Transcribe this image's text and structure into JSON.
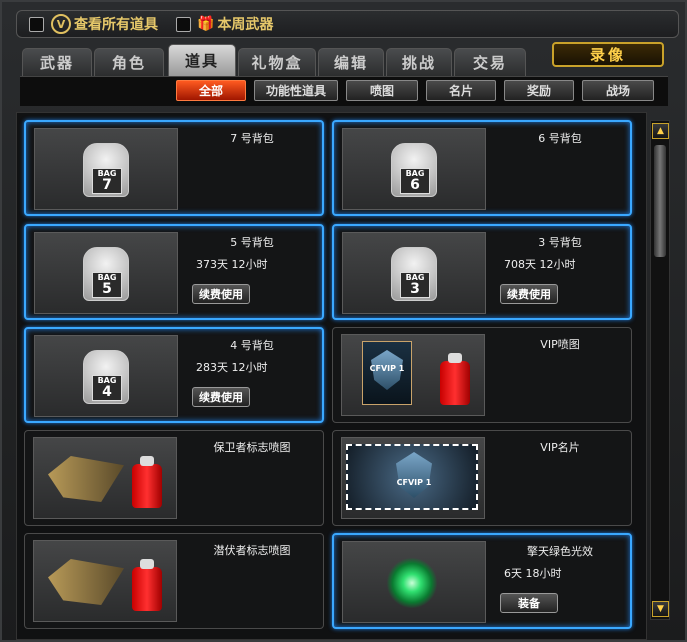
{
  "topbar": {
    "show_all_label": "查看所有道具",
    "weekly_weapons_label": "本周武器",
    "v_icon_glyph": "V",
    "gift_icon_glyph": "🎁"
  },
  "tabs": [
    "武器",
    "角色",
    "道具",
    "礼物盒",
    "编辑",
    "挑战",
    "交易"
  ],
  "active_tab_index": 2,
  "record_button": "录像",
  "subtabs": [
    "全部",
    "功能性道具",
    "喷图",
    "名片",
    "奖励",
    "战场"
  ],
  "active_subtab_index": 0,
  "items": [
    {
      "title": "7 号背包",
      "time": "",
      "button": "",
      "selected": true,
      "type": "bag",
      "bag_text": "BAG",
      "bag_number": "7"
    },
    {
      "title": "6 号背包",
      "time": "",
      "button": "",
      "selected": true,
      "type": "bag",
      "bag_text": "BAG",
      "bag_number": "6"
    },
    {
      "title": "5 号背包",
      "time": "373天 12小时",
      "button": "续费使用",
      "selected": true,
      "type": "bag",
      "bag_text": "BAG",
      "bag_number": "5"
    },
    {
      "title": "3 号背包",
      "time": "708天 12小时",
      "button": "续费使用",
      "selected": true,
      "type": "bag",
      "bag_text": "BAG",
      "bag_number": "3"
    },
    {
      "title": "4 号背包",
      "time": "283天 12小时",
      "button": "续费使用",
      "selected": true,
      "type": "bag",
      "bag_text": "BAG",
      "bag_number": "4"
    },
    {
      "title": "VIP喷图",
      "time": "",
      "button": "",
      "selected": false,
      "type": "vipspray",
      "badge_text": "CFVIP 1"
    },
    {
      "title": "保卫者标志喷图",
      "time": "",
      "button": "",
      "selected": false,
      "type": "spray"
    },
    {
      "title": "VIP名片",
      "time": "",
      "button": "",
      "selected": false,
      "type": "vipcard",
      "badge_text": "CFVIP 1"
    },
    {
      "title": "潜伏者标志喷图",
      "time": "",
      "button": "",
      "selected": false,
      "type": "spray"
    },
    {
      "title": "擎天绿色光效",
      "time": "6天 18小时",
      "button": "装备",
      "selected": true,
      "type": "glow"
    }
  ],
  "scrollbar": {
    "up_glyph": "▲",
    "down_glyph": "▼"
  },
  "colors": {
    "selection": "#3aa8ff",
    "active_subtab": "#ff5a20",
    "gold": "#e6c86a"
  }
}
